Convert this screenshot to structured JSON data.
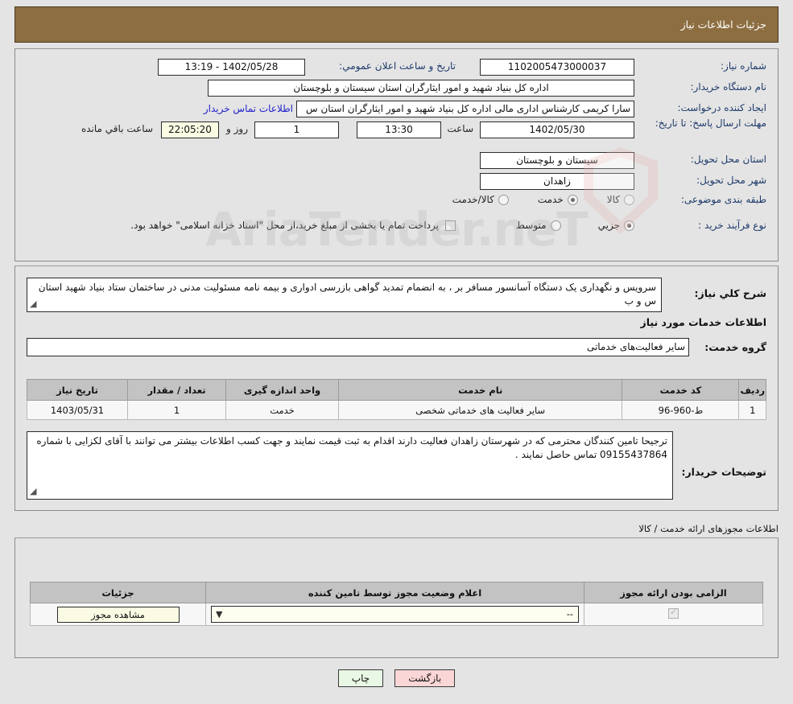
{
  "header": {
    "title": "جزئیات اطلاعات نیاز"
  },
  "watermark": {
    "text": "AriaTender.neT"
  },
  "top": {
    "need_number_label": "شماره نیاز:",
    "need_number_value": "1102005473000037",
    "announce_label": "تاریخ و ساعت اعلان عمومي:",
    "announce_value": "1402/05/28 - 13:19",
    "buyer_org_label": "نام دستگاه خریدار:",
    "buyer_org_value": "اداره کل بنیاد شهید و امور ایثارگران استان سیستان و بلوچستان",
    "creator_label": "ایجاد کننده درخواست:",
    "creator_value": "سارا کریمی کارشناس اداری مالی اداره کل بنیاد شهید و امور ایثارگران استان س",
    "contact_link": "اطلاعات تماس خریدار",
    "deadline_label": "مهلت ارسال پاسخ: تا تاریخ:",
    "deadline_date": "1402/05/30",
    "deadline_hour_label": "ساعت",
    "deadline_time": "13:30",
    "days_value": "1",
    "days_label": "روز و",
    "countdown_value": "22:05:20",
    "countdown_label": "ساعت باقي مانده",
    "province_label": "استان محل تحویل:",
    "province_value": "سیستان و بلوچستان",
    "city_label": "شهر محل تحویل:",
    "city_value": "زاهدان",
    "category_label": "طبقه بندی موضوعی:",
    "category_options": [
      {
        "label": "کالا",
        "selected": false
      },
      {
        "label": "خدمت",
        "selected": true
      },
      {
        "label": "کالا/خدمت",
        "selected": false
      }
    ],
    "process_label": "نوع فرآیند خرید :",
    "process_options": [
      {
        "label": "جزیي",
        "selected": true
      },
      {
        "label": "متوسط",
        "selected": false
      }
    ],
    "treasury_checkbox_checked": false,
    "treasury_text": "پرداخت تمام یا بخشی از مبلغ خرید،از محل \"اسناد خزانه اسلامی\" خواهد بود."
  },
  "desc": {
    "need_desc_label": "شرح کلي نیاز:",
    "need_desc_value": "سرویس و نگهداری یک دستگاه آسانسور مسافر بر ، به انضمام تمدید گواهی بازرسی ادواری و بیمه نامه مسئولیت مدنی در ساختمان ستاد بنیاد شهید استان س و ب",
    "services_section_title": "اطلاعات خدمات مورد نیاز",
    "service_group_label": "گروه خدمت:",
    "service_group_value": "سایر فعالیت‌های خدماتی",
    "table_headers": [
      "ردیف",
      "کد خدمت",
      "نام خدمت",
      "واحد اندازه گیری",
      "تعداد / مقدار",
      "تاریخ نیاز"
    ],
    "table_rows": [
      {
        "row": "1",
        "code": "ط-960-96",
        "name": "سایر فعالیت های خدماتی شخصی",
        "unit": "خدمت",
        "qty": "1",
        "date": "1403/05/31"
      }
    ],
    "buyer_notes_label": "توضیحات خریدار:",
    "buyer_notes_value": "ترجیحا تامین کنندگان محترمی که در شهرستان زاهدان فعالیت دارند اقدام به ثبت قیمت نمایند و جهت کسب اطلاعات بیشتر می توانند با آقای لکزایی با شماره 09155437864 تماس حاصل نمایند ."
  },
  "licenses": {
    "section_title": "اطلاعات مجوزهای ارائه خدمت / کالا",
    "table_headers": [
      "الزامی بودن ارائه مجوز",
      "اعلام وضعیت مجوز توسط تامین کننده",
      "جزئیات"
    ],
    "rows": [
      {
        "required_checked": true,
        "status_value": "--",
        "details_button": "مشاهده مجوز"
      }
    ]
  },
  "footer": {
    "back_label": "بازگشت",
    "print_label": "چاپ"
  }
}
